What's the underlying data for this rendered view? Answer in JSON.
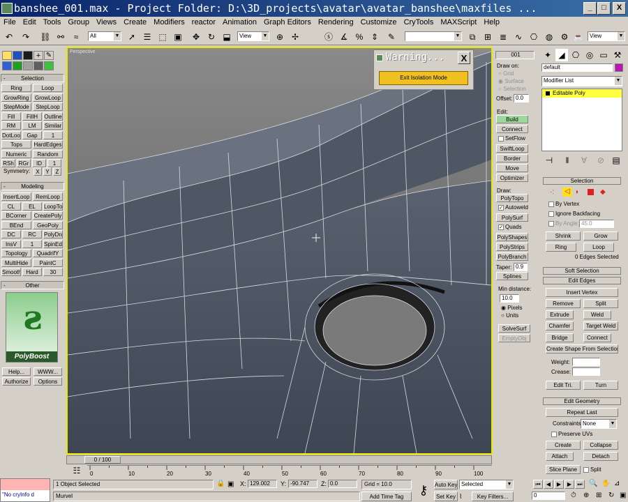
{
  "window": {
    "title": "banshee_001.max     - Project Folder: D:\\3D_projects\\avatar\\avatar_banshee\\maxfiles ...",
    "min": "_",
    "max": "□",
    "close": "X"
  },
  "menu": [
    "File",
    "Edit",
    "Tools",
    "Group",
    "Views",
    "Create",
    "Modifiers",
    "reactor",
    "Animation",
    "Graph Editors",
    "Rendering",
    "Customize",
    "CryTools",
    "MAXScript",
    "Help"
  ],
  "toolbar": {
    "selection_filter": "All",
    "ref_coord": "View",
    "view_right": "View"
  },
  "left_panel": {
    "selection_header": "Selection",
    "sel_buttons": [
      [
        "Ring",
        "Loop"
      ],
      [
        "GrowRing",
        "GrowLoop"
      ],
      [
        "StepMode",
        "StepLoop"
      ],
      [
        "Fill",
        "FillH",
        "Outline"
      ],
      [
        "RM",
        "LM",
        "Similar"
      ],
      [
        "DotLoop",
        "Gap",
        "1"
      ],
      [
        "Tops",
        "HardEdges"
      ],
      [
        "Numeric",
        "Random"
      ],
      [
        "RSh",
        "RGr",
        "ID",
        "1"
      ]
    ],
    "symmetry_label": "Symmetry:",
    "symmetry_axes": [
      "X",
      "Y",
      "Z"
    ],
    "modeling_header": "Modeling",
    "mod_buttons": [
      [
        "InsertLoop",
        "RemLoop"
      ],
      [
        "CL",
        "EL",
        "LoopTools"
      ],
      [
        "BCorner",
        "CreatePoly"
      ],
      [
        "BEnd",
        "GeoPoly"
      ],
      [
        "DC",
        "RC",
        "PolyDraw"
      ],
      [
        "InsV",
        "1",
        "SpinEdge"
      ],
      [
        "Topology",
        "QuadrifY"
      ],
      [
        "MultiHide",
        "PaintC"
      ],
      [
        "Smooth",
        "Hard",
        "30"
      ]
    ],
    "other_header": "Other",
    "logo_text": "PolyBoost",
    "other_buttons": [
      [
        "Help...",
        "WWW..."
      ],
      [
        "Authorize",
        "Options"
      ]
    ]
  },
  "viewport": {
    "label": "Perspective",
    "warning_title": "Warning...",
    "warning_button": "Exit Isolation Mode",
    "warning_close": "X"
  },
  "mid_panel": {
    "id_value": "001",
    "draw_on_label": "Draw on:",
    "draw_on_options": [
      "Grid",
      "Surface",
      "Selection"
    ],
    "offset_label": "Offset:",
    "offset_value": "0.0",
    "edit_label": "Edit:",
    "edit_buttons": [
      "Build",
      "Connect",
      "SetFlow",
      "SwiftLoop",
      "Border",
      "Move",
      "Optimizer"
    ],
    "draw_label": "Draw:",
    "draw_items": [
      "PolyTopo",
      "Autoweld",
      "PolySurf",
      "Quads",
      "PolyShapes",
      "PolyStrips",
      "PolyBranch"
    ],
    "taper_label": "Taper:",
    "taper_value": "0.9",
    "splines": "Splines",
    "min_distance_label": "Min distance:",
    "min_distance_value": "10.0",
    "units": [
      "Pixels",
      "Units"
    ],
    "solvesurf": "SolveSurf",
    "emptyobj": "EmptyObj"
  },
  "right_panel": {
    "object_name": "default",
    "object_color": "#b419b4",
    "modifier_list": "Modifier List",
    "stack_item": "Editable Poly",
    "selection_header": "Selection",
    "by_vertex": "By Vertex",
    "ignore_backfacing": "Ignore Backfacing",
    "by_angle": "By Angle:",
    "by_angle_value": "45.0",
    "shrink": "Shrink",
    "grow": "Grow",
    "ring": "Ring",
    "loop": "Loop",
    "status": "0 Edges Selected",
    "soft_selection": "Soft Selection",
    "edit_edges": "Edit Edges",
    "insert_vertex": "Insert Vertex",
    "remove": "Remove",
    "split": "Split",
    "extrude": "Extrude",
    "weld": "Weld",
    "chamfer": "Chamfer",
    "target_weld": "Target Weld",
    "bridge": "Bridge",
    "connect": "Connect",
    "create_shape": "Create Shape From Selection",
    "weight": "Weight:",
    "crease": "Crease:",
    "edit_tri": "Edit Tri.",
    "turn": "Turn",
    "edit_geometry": "Edit Geometry",
    "repeat_last": "Repeat Last",
    "constraints": "Constraints:",
    "constraints_value": "None",
    "preserve_uvs": "Preserve UVs",
    "create": "Create",
    "collapse": "Collapse",
    "attach": "Attach",
    "detach": "Detach",
    "slice_plane": "Slice Plane",
    "split2": "Split"
  },
  "timeline": {
    "frame": "0 / 100",
    "ticks": [
      "0",
      "10",
      "20",
      "30",
      "40",
      "50",
      "60",
      "70",
      "80",
      "90",
      "100"
    ]
  },
  "status_bar": {
    "maxscript": "\"No cryInfo d",
    "selected": "1 Object Selected",
    "prompt": "Murvel",
    "x_label": "X:",
    "x_value": "129.002",
    "y_label": "Y:",
    "y_value": "-90.747",
    "z_label": "Z:",
    "z_value": "0.0",
    "grid": "Grid = 10.0",
    "add_time_tag": "Add Time Tag",
    "auto_key": "Auto Key",
    "set_key": "Set Key",
    "key_mode": "Selected",
    "key_filters": "Key Filters...",
    "current_frame": "0"
  }
}
